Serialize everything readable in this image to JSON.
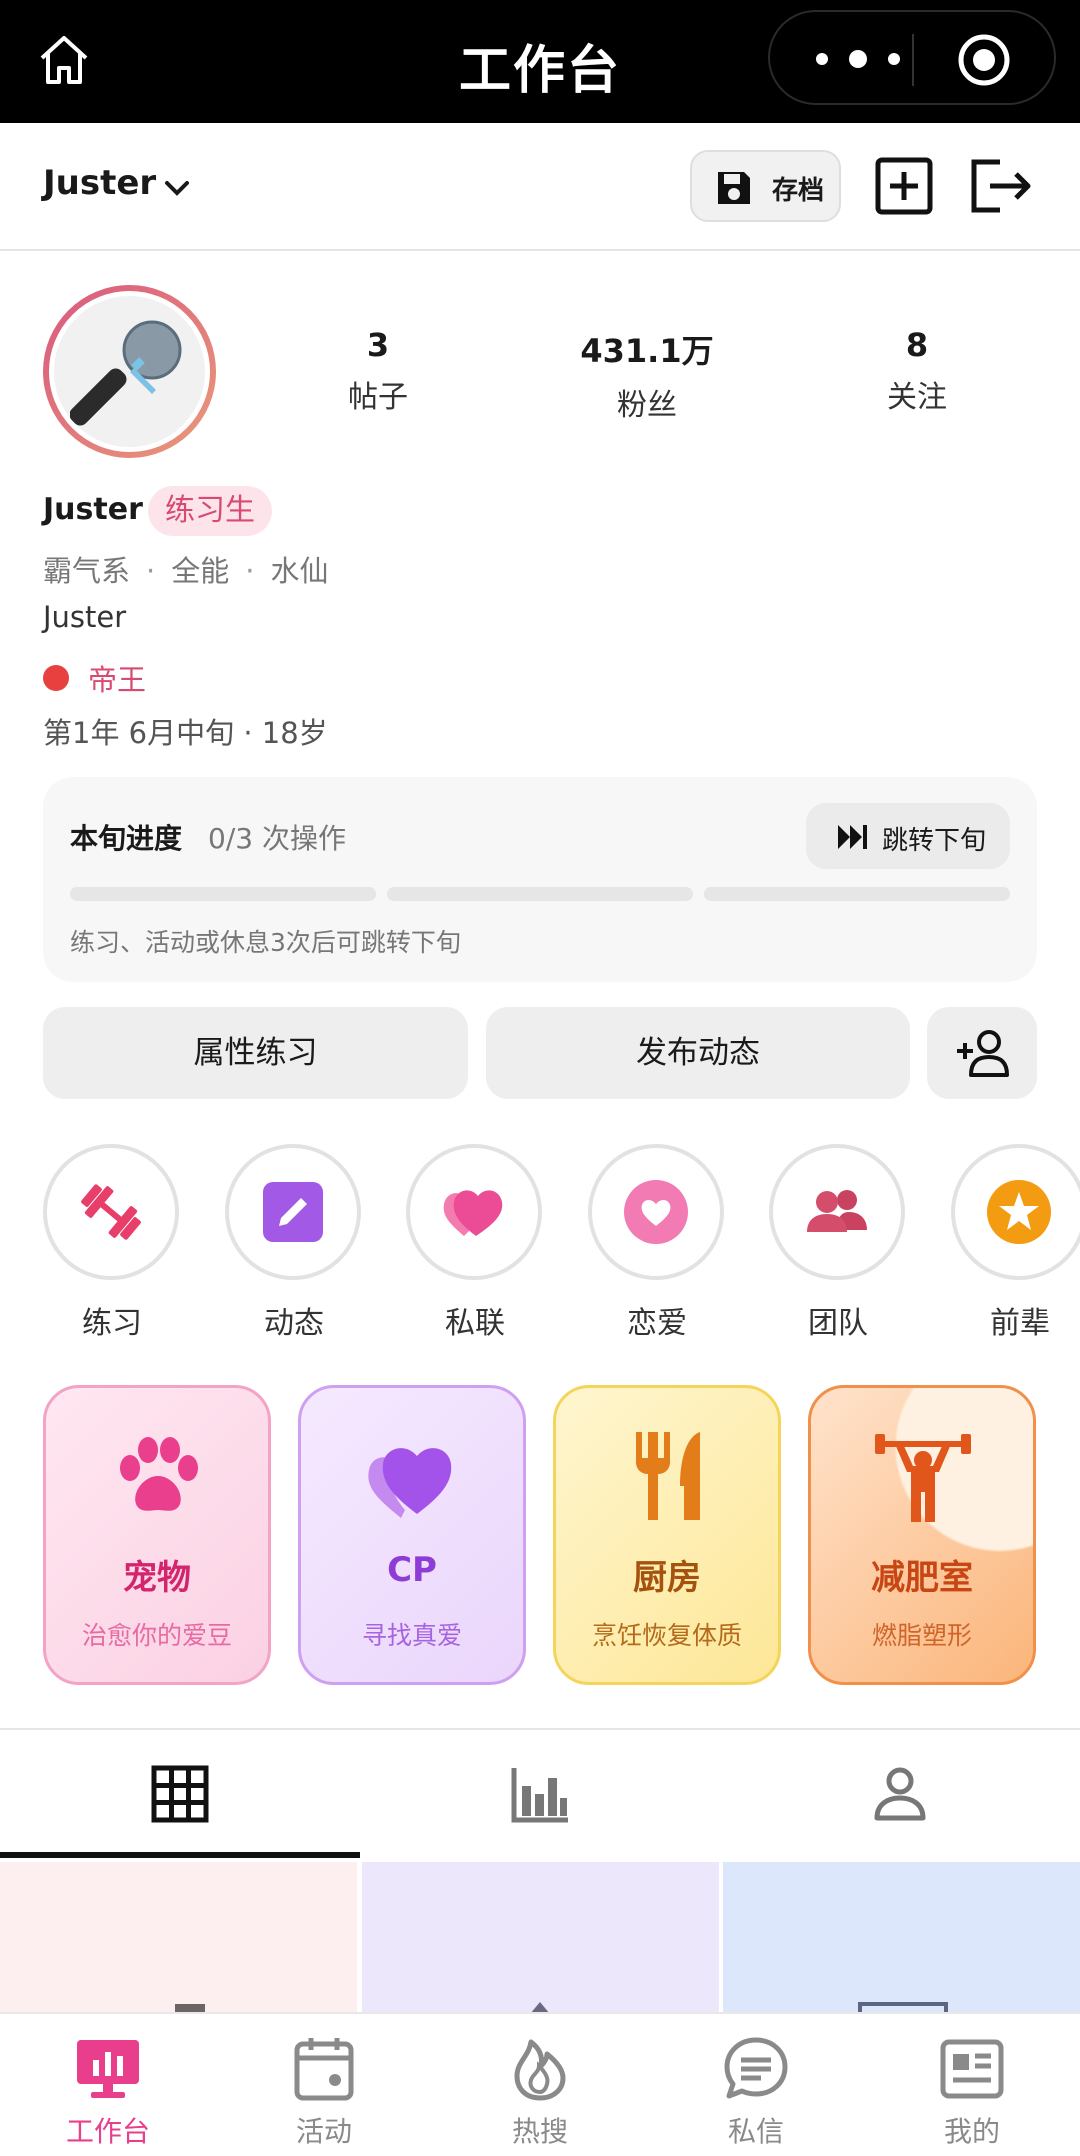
{
  "topbar": {
    "title": "工作台"
  },
  "account": {
    "name": "Juster",
    "save_label": "存档"
  },
  "profile": {
    "stats": [
      {
        "num": "3",
        "label": "帖子"
      },
      {
        "num": "431.1万",
        "label": "粉丝"
      },
      {
        "num": "8",
        "label": "关注"
      }
    ],
    "name": "Juster",
    "rank": "练习生",
    "tags": [
      "霸气系",
      "全能",
      "水仙"
    ],
    "bio": "Juster",
    "title": "帝王",
    "period": "第1年 6月中旬 · 18岁"
  },
  "progress": {
    "title": "本旬进度",
    "count": "0/3 次操作",
    "done": 0,
    "total": 3,
    "skip_label": "跳转下旬",
    "hint": "练习、活动或休息3次后可跳转下旬"
  },
  "actions": {
    "practice": "属性练习",
    "post": "发布动态"
  },
  "icon_row": [
    {
      "label": "练习",
      "icon": "dumbbell-icon"
    },
    {
      "label": "动态",
      "icon": "edit-icon"
    },
    {
      "label": "私联",
      "icon": "heart-icon"
    },
    {
      "label": "恋爱",
      "icon": "love-icon"
    },
    {
      "label": "团队",
      "icon": "group-icon"
    },
    {
      "label": "前辈",
      "icon": "star-icon"
    }
  ],
  "feature_cards": [
    {
      "title": "宠物",
      "subtitle": "治愈你的爱豆",
      "icon": "paw-icon"
    },
    {
      "title": "CP",
      "subtitle": "寻找真爱",
      "icon": "heart-icon"
    },
    {
      "title": "厨房",
      "subtitle": "烹饪恢复体质",
      "icon": "utensils-icon"
    },
    {
      "title": "减肥室",
      "subtitle": "燃脂塑形",
      "icon": "weightlifter-icon"
    }
  ],
  "bottom_nav": [
    {
      "label": "工作台",
      "active": true
    },
    {
      "label": "活动"
    },
    {
      "label": "热搜"
    },
    {
      "label": "私信"
    },
    {
      "label": "我的"
    }
  ],
  "colors": {
    "accent": "#e83e8c",
    "rank_text": "#d94a72",
    "title_dot": "#e8403e"
  }
}
